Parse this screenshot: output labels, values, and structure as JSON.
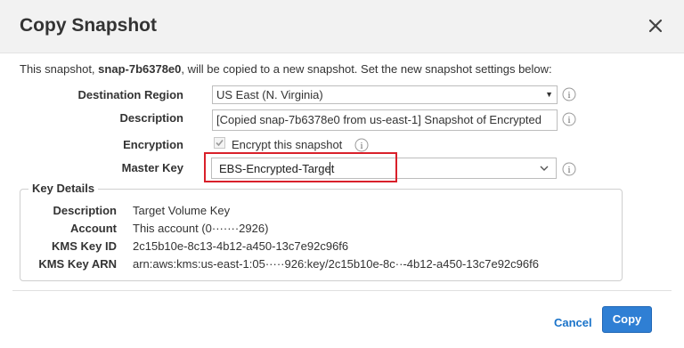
{
  "dialog": {
    "title": "Copy Snapshot",
    "intro_prefix": "This snapshot,",
    "snapshot_id": "snap-7b6378e0",
    "intro_suffix": ", will be copied to a new snapshot. Set the new snapshot settings below:"
  },
  "form": {
    "destination_region": {
      "label": "Destination Region",
      "value": "US East (N. Virginia)"
    },
    "description": {
      "label": "Description",
      "value": "[Copied snap-7b6378e0 from us-east-1] Snapshot of Encrypted"
    },
    "encryption": {
      "label": "Encryption",
      "checkbox_label": "Encrypt this snapshot",
      "checked": true
    },
    "master_key": {
      "label": "Master Key",
      "value": "EBS-Encrypted-Target"
    }
  },
  "key_details": {
    "legend": "Key Details",
    "rows": [
      {
        "label": "Description",
        "value": "Target Volume Key"
      },
      {
        "label": "Account",
        "value": "This account (0·······2926)"
      },
      {
        "label": "KMS Key ID",
        "value": "2c15b10e-8c13-4b12-a450-13c7e92c96f6"
      },
      {
        "label": "KMS Key ARN",
        "value": "arn:aws:kms:us-east-1:05·····926:key/2c15b10e-8c··-4b12-a450-13c7e92c96f6"
      }
    ]
  },
  "footer": {
    "cancel_label": "Cancel",
    "copy_label": "Copy"
  },
  "colors": {
    "primary": "#2f7fd4",
    "link": "#1a73c9",
    "highlight": "#d9202a"
  }
}
